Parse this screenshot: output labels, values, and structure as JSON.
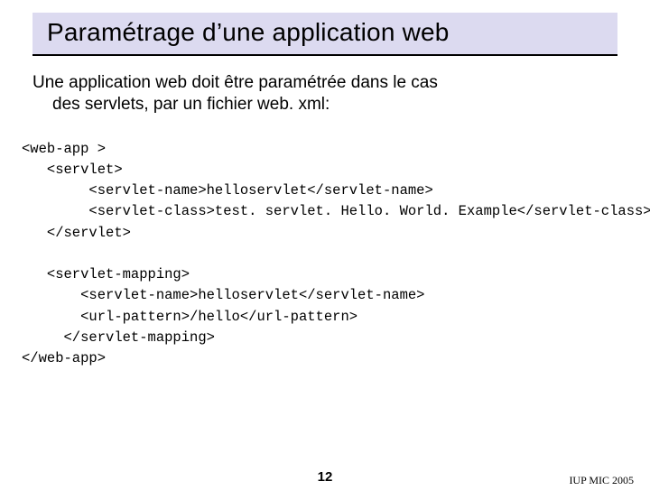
{
  "title": "Paramétrage d’une application web",
  "body": {
    "line1": "Une application web doit être paramétrée dans le cas",
    "line2": "des servlets, par un fichier web. xml:"
  },
  "code": "<web-app >\n   <servlet>\n        <servlet-name>helloservlet</servlet-name>\n        <servlet-class>test. servlet. Hello. World. Example</servlet-class>\n   </servlet>\n\n   <servlet-mapping>\n       <servlet-name>helloservlet</servlet-name>\n       <url-pattern>/hello</url-pattern>\n     </servlet-mapping>\n</web-app>",
  "footer": {
    "page": "12",
    "credit": "IUP MIC 2005"
  }
}
